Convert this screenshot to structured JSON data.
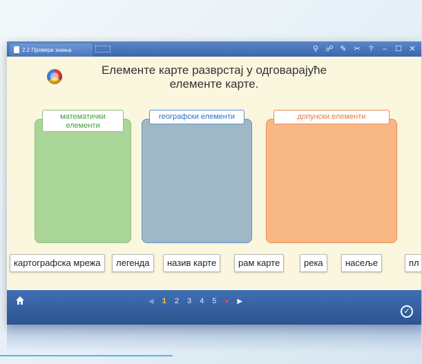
{
  "window": {
    "tab_title": "2.2 Провера знања",
    "controls": [
      "⚲",
      "☍",
      "✎",
      "✂",
      "?",
      "–",
      "☐",
      "✕"
    ]
  },
  "instruction": {
    "line1": "Елементе карте разврстај у одговарајуће",
    "line2": "елементе карте."
  },
  "columns": [
    {
      "label": "математички елементи",
      "color": "#a9d599"
    },
    {
      "label": "географски елементи",
      "color": "#9fb8c6"
    },
    {
      "label": "допунски елементи",
      "color": "#f7b886"
    }
  ],
  "cards": [
    "картографска мрежа",
    "легенда",
    "назив карте",
    "рам карте",
    "река",
    "насеље",
    "пл"
  ],
  "pager": {
    "pages": [
      "1",
      "2",
      "3",
      "4",
      "5"
    ],
    "active": "1",
    "prev_icon": "◀",
    "next_icon": "▶",
    "record_icon": "●"
  },
  "icons": {
    "home": "home-icon",
    "check": "check-circle-icon"
  },
  "colors": {
    "accent": "#3b67ad",
    "background": "#fbf6de",
    "active_page": "#ffcc33"
  }
}
